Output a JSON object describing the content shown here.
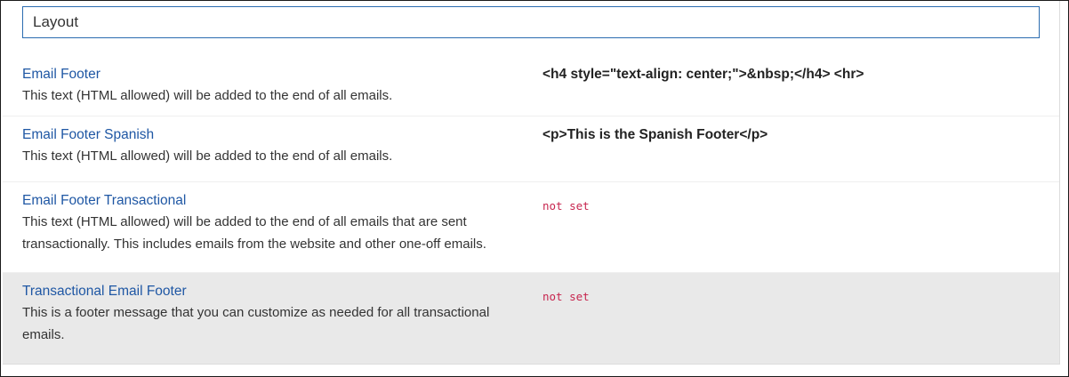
{
  "section": {
    "title": "Layout"
  },
  "settings": [
    {
      "name": "Email Footer",
      "description": "This text (HTML allowed) will be added to the end of all emails.",
      "value": "<h4 style=\"text-align: center;\">&nbsp;</h4> <hr>"
    },
    {
      "name": "Email Footer Spanish",
      "description": "This text (HTML allowed) will be added to the end of all emails.",
      "value": "<p>This is the Spanish Footer</p>"
    },
    {
      "name": "Email Footer Transactional",
      "description": "This text (HTML allowed) will be added to the end of all emails that are sent transactionally. This includes emails from the website and other one-off emails.",
      "value": "not set"
    },
    {
      "name": "Transactional Email Footer",
      "description": "This is a footer message that you can customize as needed for all transactional emails.",
      "value": "not set"
    }
  ],
  "colors": {
    "link": "#1f57a4",
    "unset_value": "#c7254e",
    "header_border": "#2b6cb0",
    "highlight_row": "#e9e9e9"
  }
}
